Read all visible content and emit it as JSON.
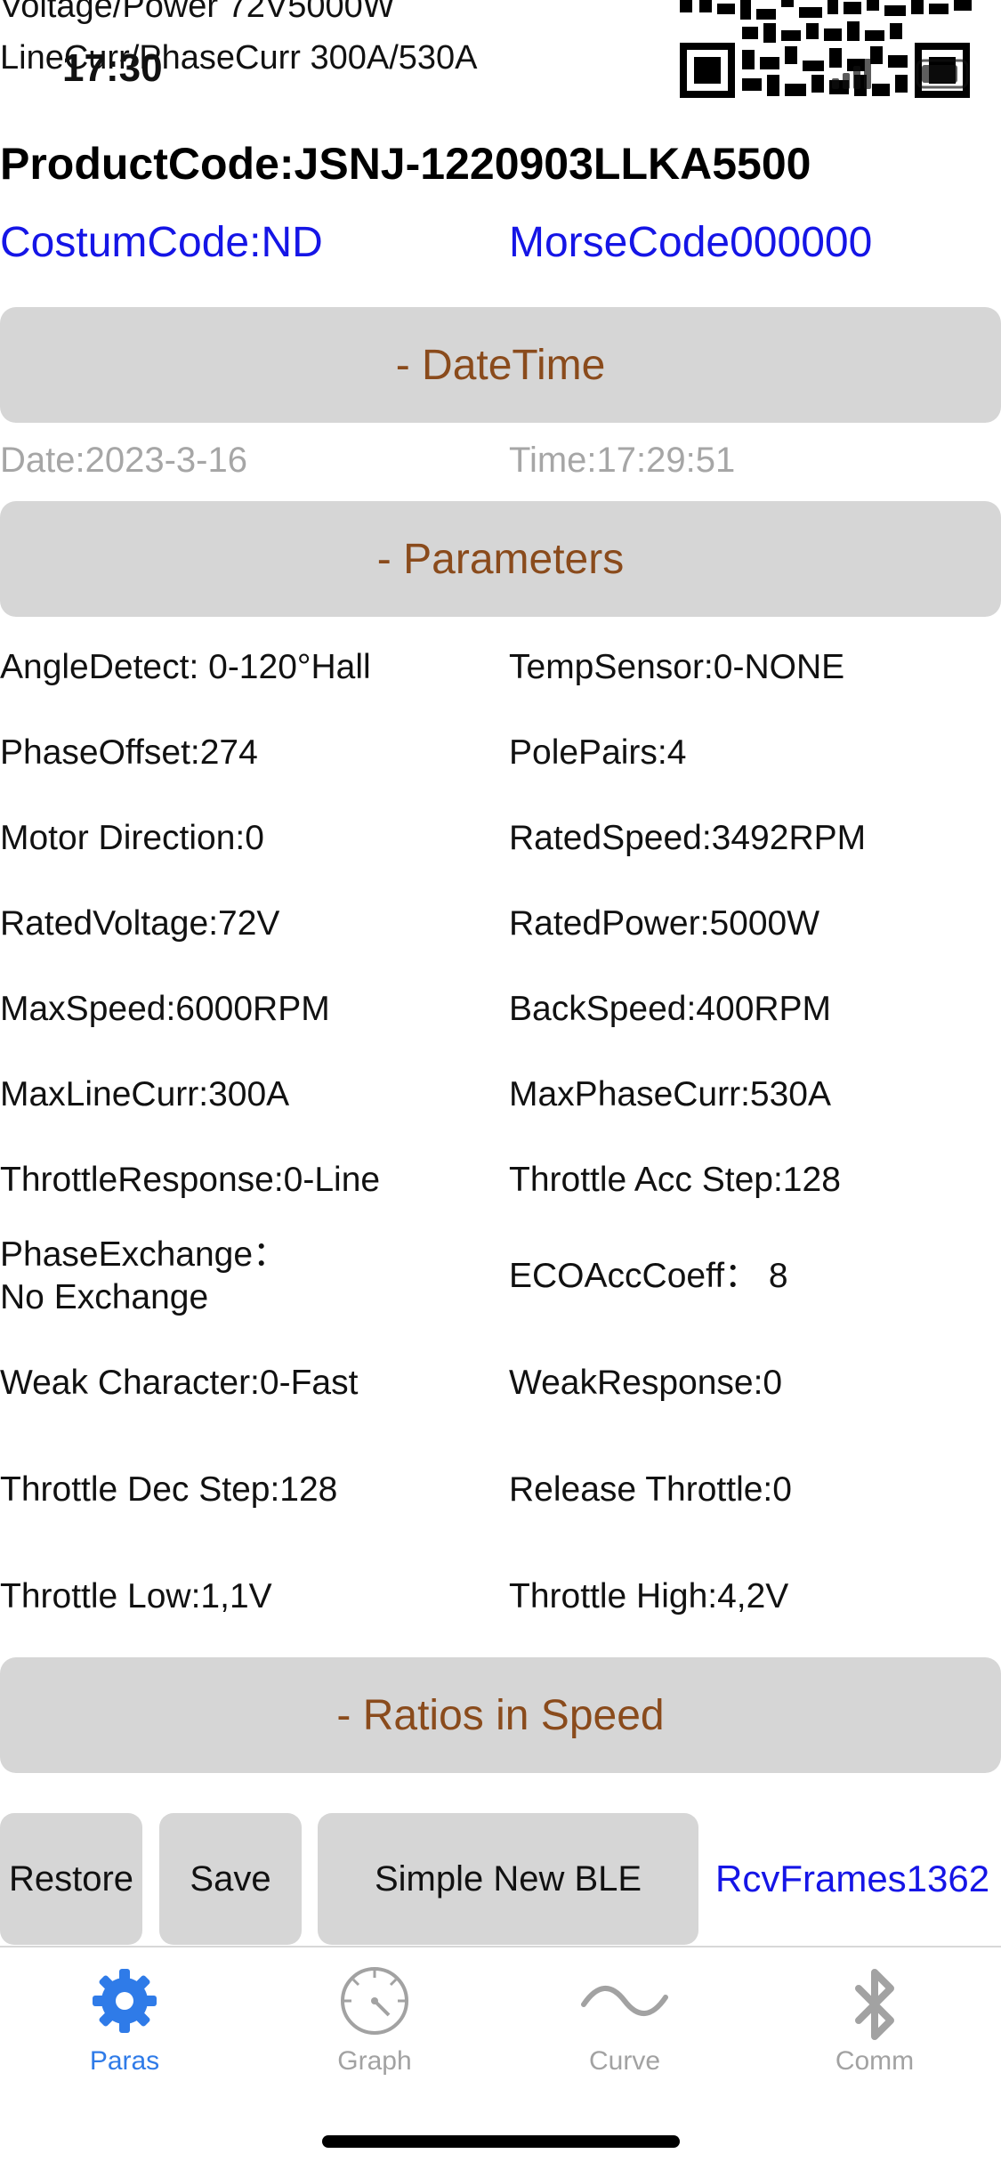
{
  "status_bar": {
    "time": "17:30"
  },
  "header": {
    "line1": "Voltage/Power   72V5000W",
    "line2": "LineCurr/PhaseCurr   300A/530A",
    "product_code": "ProductCode:JSNJ-1220903LLKA5500",
    "custom_code": "CostumCode:ND",
    "morse_code": "MorseCode000000"
  },
  "sections": {
    "datetime_title": "- DateTime",
    "parameters_title": "- Parameters",
    "ratios_title": "- Ratios in Speed"
  },
  "datetime": {
    "date": "Date:2023-3-16",
    "time": "Time:17:29:51"
  },
  "parameters": {
    "left": [
      "AngleDetect: 0-120°Hall",
      "PhaseOffset:274",
      "Motor Direction:0",
      "RatedVoltage:72V",
      "MaxSpeed:6000RPM",
      "MaxLineCurr:300A",
      "ThrottleResponse:0-Line",
      "PhaseExchange：",
      "No Exchange",
      "Weak Character:0-Fast",
      "Throttle Dec Step:128",
      "Throttle Low:1,1V"
    ],
    "right": [
      "TempSensor:0-NONE",
      "PolePairs:4",
      "RatedSpeed:3492RPM",
      "RatedPower:5000W",
      "BackSpeed:400RPM",
      "MaxPhaseCurr:530A",
      "Throttle Acc Step:128",
      "ECOAccCoeff：  8",
      "WeakResponse:0",
      "Release Throttle:0",
      "Throttle High:4,2V"
    ]
  },
  "actions": {
    "restore_label": "Restore",
    "save_label": "Save",
    "ble_label": "Simple New BLE",
    "rcv_frames": "RcvFrames1362"
  },
  "tabbar": {
    "tabs": [
      {
        "label": "Paras",
        "icon": "gear-icon",
        "active": true
      },
      {
        "label": "Graph",
        "icon": "gauge-icon",
        "active": false
      },
      {
        "label": "Curve",
        "icon": "sine-wave-icon",
        "active": false
      },
      {
        "label": "Comm",
        "icon": "bluetooth-icon",
        "active": false
      }
    ],
    "active_color": "#2f7be8",
    "inactive_color": "#a2a2a2"
  },
  "colors": {
    "section_bg": "#d6d6d6",
    "section_text": "#8a4b1c",
    "link_blue": "#1515e6",
    "muted_grey": "#a6a6a6"
  }
}
